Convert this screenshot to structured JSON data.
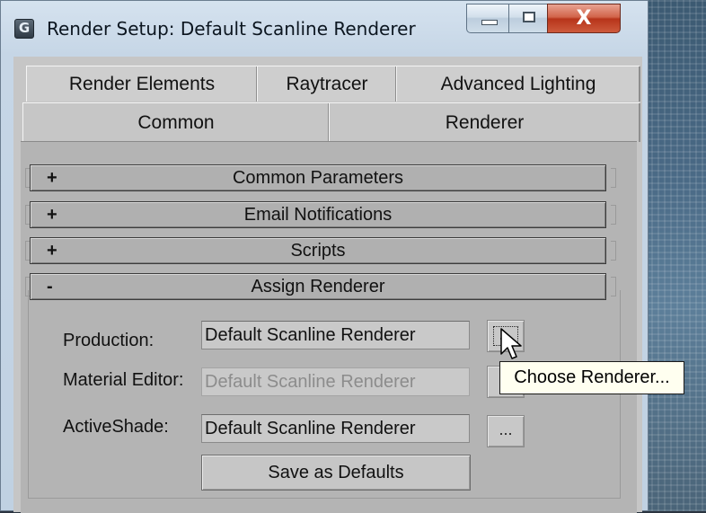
{
  "window": {
    "title": "Render Setup: Default Scanline Renderer",
    "app_icon_glyph": "G",
    "min_icon": "minimize-icon",
    "max_icon": "maximize-icon",
    "close_glyph": "X"
  },
  "tabs": {
    "row1": [
      "Render Elements",
      "Raytracer",
      "Advanced Lighting"
    ],
    "row2": [
      "Common",
      "Renderer"
    ],
    "active": "Common"
  },
  "rollouts": [
    {
      "sign": "+",
      "label": "Common Parameters"
    },
    {
      "sign": "+",
      "label": "Email Notifications"
    },
    {
      "sign": "+",
      "label": "Scripts"
    },
    {
      "sign": "-",
      "label": "Assign Renderer"
    }
  ],
  "assign_renderer": {
    "production_label": "Production:",
    "production_value": "Default Scanline Renderer",
    "material_editor_label": "Material Editor:",
    "material_editor_value": "Default Scanline Renderer",
    "activeshade_label": "ActiveShade:",
    "activeshade_value": "Default Scanline Renderer",
    "choose_button_label": "...",
    "save_defaults_label": "Save as Defaults"
  },
  "tooltip": {
    "text": "Choose Renderer..."
  },
  "colors": {
    "panel": "#b4b4b4",
    "tooltip_bg": "#fffff0",
    "close_button": "#c44a2e"
  }
}
